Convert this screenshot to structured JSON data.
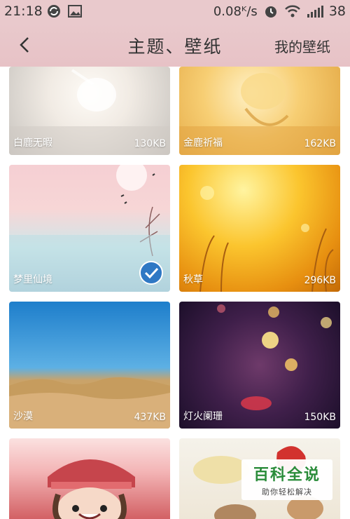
{
  "status_bar": {
    "time": "21:18",
    "net_speed": "0.08ᴷ/s",
    "battery": "38",
    "icons": [
      "sync-icon",
      "image-icon",
      "alarm-icon",
      "wifi-icon",
      "signal-icon",
      "battery-icon"
    ]
  },
  "header": {
    "title": "主题、壁纸",
    "my_wallpaper": "我的壁纸",
    "back_icon": "chevron-left-icon"
  },
  "wallpapers": [
    {
      "name": "白鹿无暇",
      "size": "130KB"
    },
    {
      "name": "金鹿祈福",
      "size": "162KB"
    },
    {
      "name": "梦里仙境",
      "size": "",
      "selected": true
    },
    {
      "name": "秋草",
      "size": "296KB"
    },
    {
      "name": "沙漠",
      "size": "437KB"
    },
    {
      "name": "灯火阑珊",
      "size": "150KB"
    },
    {
      "name": "",
      "size": ""
    },
    {
      "name": "",
      "size": ""
    }
  ],
  "watermark": {
    "title": "百科全说",
    "subtitle": "助你轻松解决"
  },
  "colors": {
    "header_bg": "#e9c9cc",
    "check_blue": "#2f78c4"
  }
}
